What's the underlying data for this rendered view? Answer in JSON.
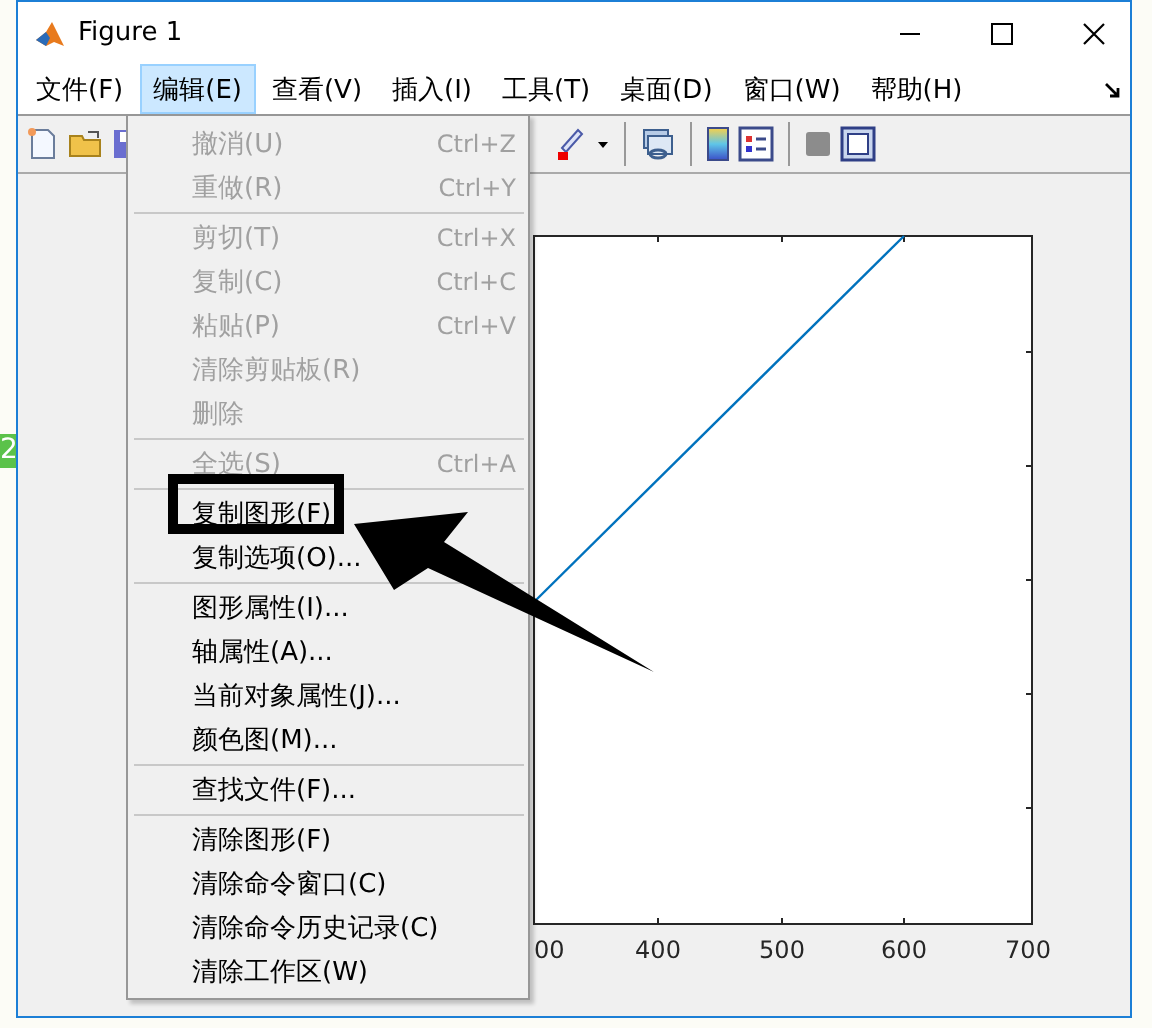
{
  "background": {
    "left_badge": "2"
  },
  "window": {
    "title": "Figure 1"
  },
  "menubar": [
    {
      "label": "文件(F)",
      "selected": false
    },
    {
      "label": "编辑(E)",
      "selected": true
    },
    {
      "label": "查看(V)",
      "selected": false
    },
    {
      "label": "插入(I)",
      "selected": false
    },
    {
      "label": "工具(T)",
      "selected": false
    },
    {
      "label": "桌面(D)",
      "selected": false
    },
    {
      "label": "窗口(W)",
      "selected": false
    },
    {
      "label": "帮助(H)",
      "selected": false
    }
  ],
  "edit_menu": [
    {
      "kind": "item",
      "label": "撤消(U)",
      "shortcut": "Ctrl+Z",
      "disabled": true
    },
    {
      "kind": "item",
      "label": "重做(R)",
      "shortcut": "Ctrl+Y",
      "disabled": true
    },
    {
      "kind": "separator"
    },
    {
      "kind": "item",
      "label": "剪切(T)",
      "shortcut": "Ctrl+X",
      "disabled": true
    },
    {
      "kind": "item",
      "label": "复制(C)",
      "shortcut": "Ctrl+C",
      "disabled": true
    },
    {
      "kind": "item",
      "label": "粘贴(P)",
      "shortcut": "Ctrl+V",
      "disabled": true
    },
    {
      "kind": "item",
      "label": "清除剪贴板(R)",
      "disabled": true
    },
    {
      "kind": "item",
      "label": "删除",
      "disabled": true
    },
    {
      "kind": "separator"
    },
    {
      "kind": "item",
      "label": "全选(S)",
      "shortcut": "Ctrl+A",
      "disabled": true
    },
    {
      "kind": "separator"
    },
    {
      "kind": "item",
      "label": "复制图形(F)",
      "disabled": false
    },
    {
      "kind": "item",
      "label": "复制选项(O)...",
      "disabled": false
    },
    {
      "kind": "separator"
    },
    {
      "kind": "item",
      "label": "图形属性(I)...",
      "disabled": false
    },
    {
      "kind": "item",
      "label": "轴属性(A)...",
      "disabled": false
    },
    {
      "kind": "item",
      "label": "当前对象属性(J)...",
      "disabled": false
    },
    {
      "kind": "item",
      "label": "颜色图(M)...",
      "disabled": false
    },
    {
      "kind": "separator"
    },
    {
      "kind": "item",
      "label": "查找文件(F)...",
      "disabled": false
    },
    {
      "kind": "separator"
    },
    {
      "kind": "item",
      "label": "清除图形(F)",
      "disabled": false
    },
    {
      "kind": "item",
      "label": "清除命令窗口(C)",
      "disabled": false
    },
    {
      "kind": "item",
      "label": "清除命令历史记录(C)",
      "disabled": false
    },
    {
      "kind": "item",
      "label": "清除工作区(W)",
      "disabled": false
    }
  ],
  "axes": {
    "x_tick_labels": [
      "00",
      "400",
      "500",
      "600",
      "700"
    ]
  }
}
